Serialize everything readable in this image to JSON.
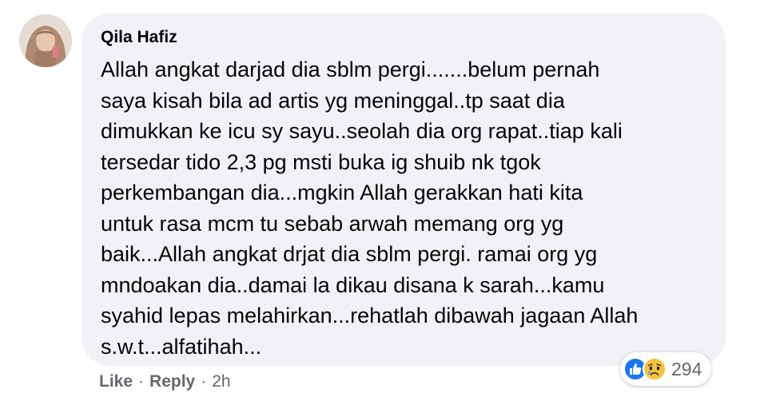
{
  "comment": {
    "author": "Qila Hafiz",
    "lines": [
      "Allah angkat darjad dia sblm pergi.......belum pernah",
      "saya kisah bila ad artis yg meninggal..tp saat dia",
      "dimukkan ke icu sy sayu..seolah dia org rapat..tiap kali",
      "tersedar tido 2,3 pg msti buka ig shuib nk tgok",
      "perkembangan dia...mgkin Allah gerakkan hati kita",
      "untuk rasa mcm tu sebab arwah memang org yg",
      "baik...Allah angkat drjat dia sblm pergi. ramai org yg",
      "mndoakan dia..damai la dikau disana k sarah...kamu",
      "syahid lepas melahirkan...rehatlah dibawah jagaan Allah",
      "s.w.t...alfatihah..."
    ]
  },
  "actions": {
    "like_label": "Like",
    "separator": "·",
    "reply_label": "Reply",
    "time": "2h"
  },
  "reactions": {
    "icons": [
      "like-icon",
      "sad-icon"
    ],
    "count": "294"
  },
  "colors": {
    "bubble": "#f0f2f5",
    "meta_text": "#65676b",
    "like_blue": "#1877f2",
    "sad_yellow": "#f7c23c"
  }
}
